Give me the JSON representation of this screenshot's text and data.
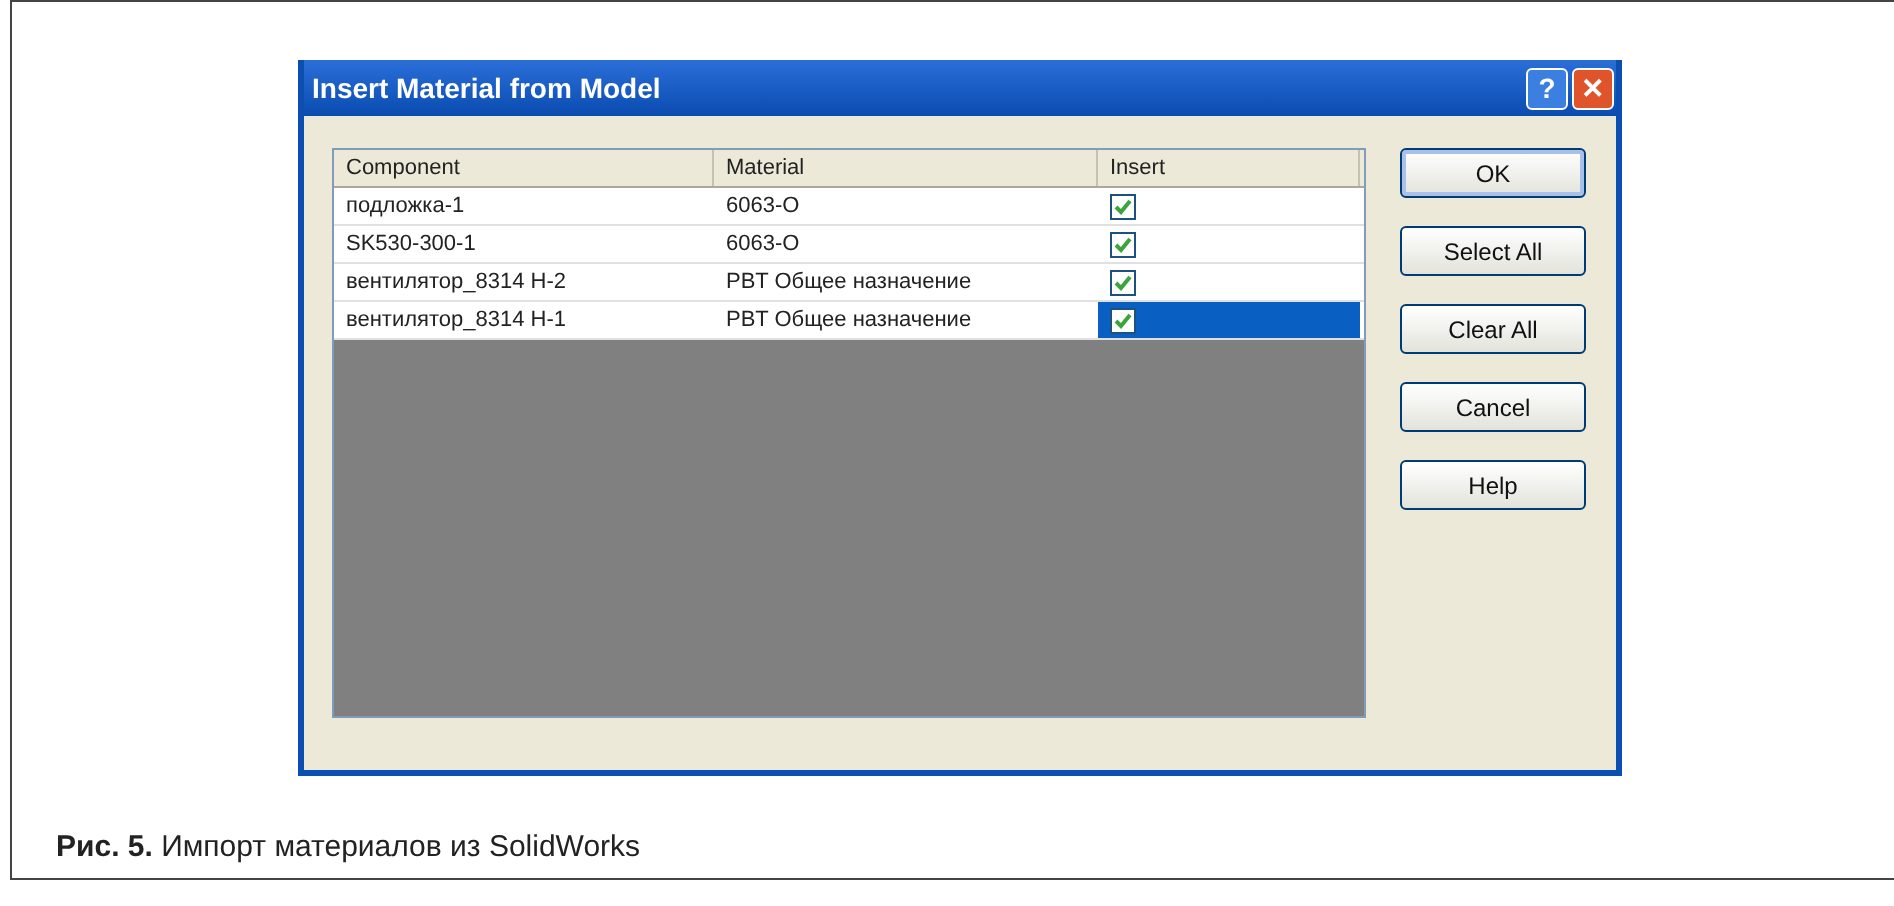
{
  "window": {
    "title": "Insert Material from Model"
  },
  "title_buttons": [
    {
      "kind": "help",
      "label": "?"
    },
    {
      "kind": "close",
      "label": "✕"
    }
  ],
  "table": {
    "columns": [
      "Component",
      "Material",
      "Insert"
    ],
    "rows": [
      {
        "component": "подложка-1",
        "material": "6063-O",
        "checked": true,
        "selected": false
      },
      {
        "component": "SK530-300-1",
        "material": "6063-O",
        "checked": true,
        "selected": false
      },
      {
        "component": "вентилятор_8314 H-2",
        "material": "PBT Общее назначение",
        "checked": true,
        "selected": false
      },
      {
        "component": "вентилятор_8314 H-1",
        "material": "PBT Общее назначение",
        "checked": true,
        "selected": true
      }
    ]
  },
  "buttons": [
    {
      "label": "OK",
      "default": true
    },
    {
      "label": "Select All",
      "default": false
    },
    {
      "label": "Clear All",
      "default": false
    },
    {
      "label": "Cancel",
      "default": false
    },
    {
      "label": "Help",
      "default": false
    }
  ],
  "caption": "**Рис. 5.** Импорт материалов из SolidWorks"
}
